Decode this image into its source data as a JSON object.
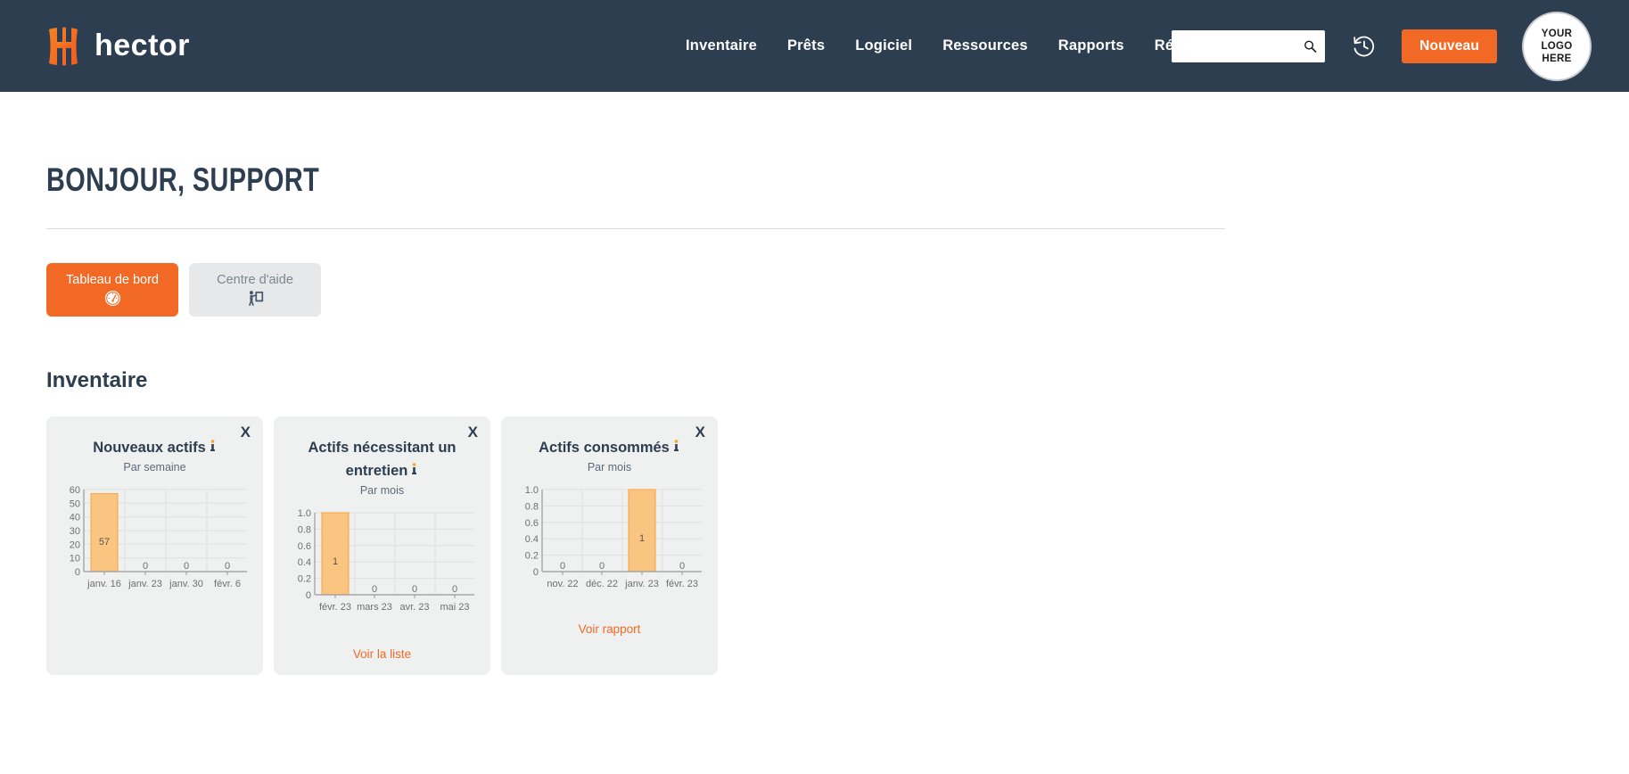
{
  "header": {
    "brand_name": "hector",
    "brand_icon": "hector-shield-h-logo",
    "nav": [
      {
        "label": "Inventaire"
      },
      {
        "label": "Prêts"
      },
      {
        "label": "Logiciel"
      },
      {
        "label": "Ressources"
      },
      {
        "label": "Rapports"
      },
      {
        "label": "Réglages"
      }
    ],
    "search": {
      "value": "",
      "placeholder": "",
      "icon": "search-icon"
    },
    "history_icon": "clock-rewind-icon",
    "new_button": "Nouveau",
    "avatar": {
      "line1": "YOUR",
      "line2": "LOGO",
      "line3": "HERE"
    }
  },
  "page": {
    "greeting": "BONJOUR, SUPPORT",
    "section_title": "Inventaire"
  },
  "tabs": [
    {
      "label": "Tableau de bord",
      "icon": "gauge-dashboard-icon",
      "active": true
    },
    {
      "label": "Centre d'aide",
      "icon": "presentation-teacher-icon",
      "active": false
    }
  ],
  "cards": [
    {
      "title": "Nouveaux actifs",
      "info_icon": "info-icon",
      "subtitle": "Par semaine",
      "close": "X",
      "link": ""
    },
    {
      "title": "Actifs nécessitant un entretien",
      "info_icon": "info-icon",
      "subtitle": "Par mois",
      "close": "X",
      "link": "Voir la liste"
    },
    {
      "title": "Actifs consommés",
      "info_icon": "info-icon",
      "subtitle": "Par mois",
      "close": "X",
      "link": "Voir rapport"
    }
  ],
  "colors": {
    "header_bg": "#2d3e50",
    "accent": "#f26925",
    "bar_fill": "#fac580",
    "bar_stroke": "#f5a33c",
    "card_bg": "#eff0f0"
  },
  "chart_data": [
    {
      "type": "bar",
      "title": "Nouveaux actifs",
      "subtitle": "Par semaine",
      "categories": [
        "janv. 16",
        "janv. 23",
        "janv. 30",
        "févr. 6"
      ],
      "values": [
        57,
        0,
        0,
        0
      ],
      "yticks": [
        0,
        10,
        20,
        30,
        40,
        50,
        60
      ],
      "ylim": [
        0,
        60
      ],
      "xlabel": "",
      "ylabel": "",
      "grid": true,
      "legend": "none"
    },
    {
      "type": "bar",
      "title": "Actifs nécessitant un entretien",
      "subtitle": "Par mois",
      "categories": [
        "févr. 23",
        "mars 23",
        "avr. 23",
        "mai 23"
      ],
      "values": [
        1,
        0,
        0,
        0
      ],
      "yticks": [
        0,
        0.2,
        0.4,
        0.6,
        0.8,
        1.0
      ],
      "ytick_labels": [
        "0",
        "0.2",
        "0.4",
        "0.6",
        "0.8",
        "1.0"
      ],
      "ylim": [
        0,
        1
      ],
      "xlabel": "",
      "ylabel": "",
      "grid": true,
      "legend": "none"
    },
    {
      "type": "bar",
      "title": "Actifs consommés",
      "subtitle": "Par mois",
      "categories": [
        "nov. 22",
        "déc. 22",
        "janv. 23",
        "févr. 23"
      ],
      "values": [
        0,
        0,
        1,
        0
      ],
      "yticks": [
        0,
        0.2,
        0.4,
        0.6,
        0.8,
        1.0
      ],
      "ytick_labels": [
        "0",
        "0.2",
        "0.4",
        "0.6",
        "0.8",
        "1.0"
      ],
      "ylim": [
        0,
        1
      ],
      "xlabel": "",
      "ylabel": "",
      "grid": true,
      "legend": "none"
    }
  ]
}
